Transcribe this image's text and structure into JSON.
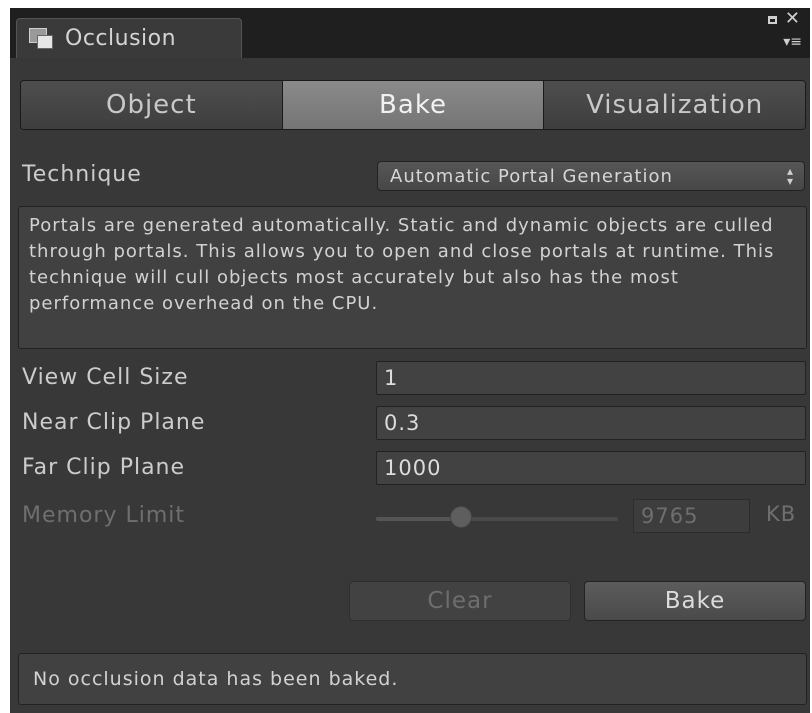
{
  "window": {
    "title": "Occlusion",
    "icons": {
      "tab": "occlusion-window-icon",
      "maximize": "maximize-icon",
      "close": "close-icon",
      "menu": "menu-icon"
    }
  },
  "tabs": [
    {
      "label": "Object",
      "active": false
    },
    {
      "label": "Bake",
      "active": true
    },
    {
      "label": "Visualization",
      "active": false
    }
  ],
  "technique": {
    "label": "Technique",
    "value": "Automatic Portal Generation"
  },
  "description": "Portals are generated automatically. Static and dynamic objects are culled through portals. This allows you to open and close portals at runtime. This technique will cull objects most accurately but also has the most performance overhead on the CPU.",
  "fields": {
    "view_cell_size": {
      "label": "View Cell Size",
      "value": "1"
    },
    "near_clip_plane": {
      "label": "Near Clip Plane",
      "value": "0.3"
    },
    "far_clip_plane": {
      "label": "Far Clip Plane",
      "value": "1000"
    }
  },
  "memory_limit": {
    "label": "Memory Limit",
    "value": "9765",
    "unit": "KB",
    "slider_fraction": 0.35,
    "enabled": false
  },
  "buttons": {
    "clear": "Clear",
    "bake": "Bake"
  },
  "status": "No occlusion data has been baked.",
  "colors": {
    "panel": "#383838",
    "active_tab": "#808080",
    "text": "#cccccc",
    "disabled_text": "#6f6f6f"
  }
}
